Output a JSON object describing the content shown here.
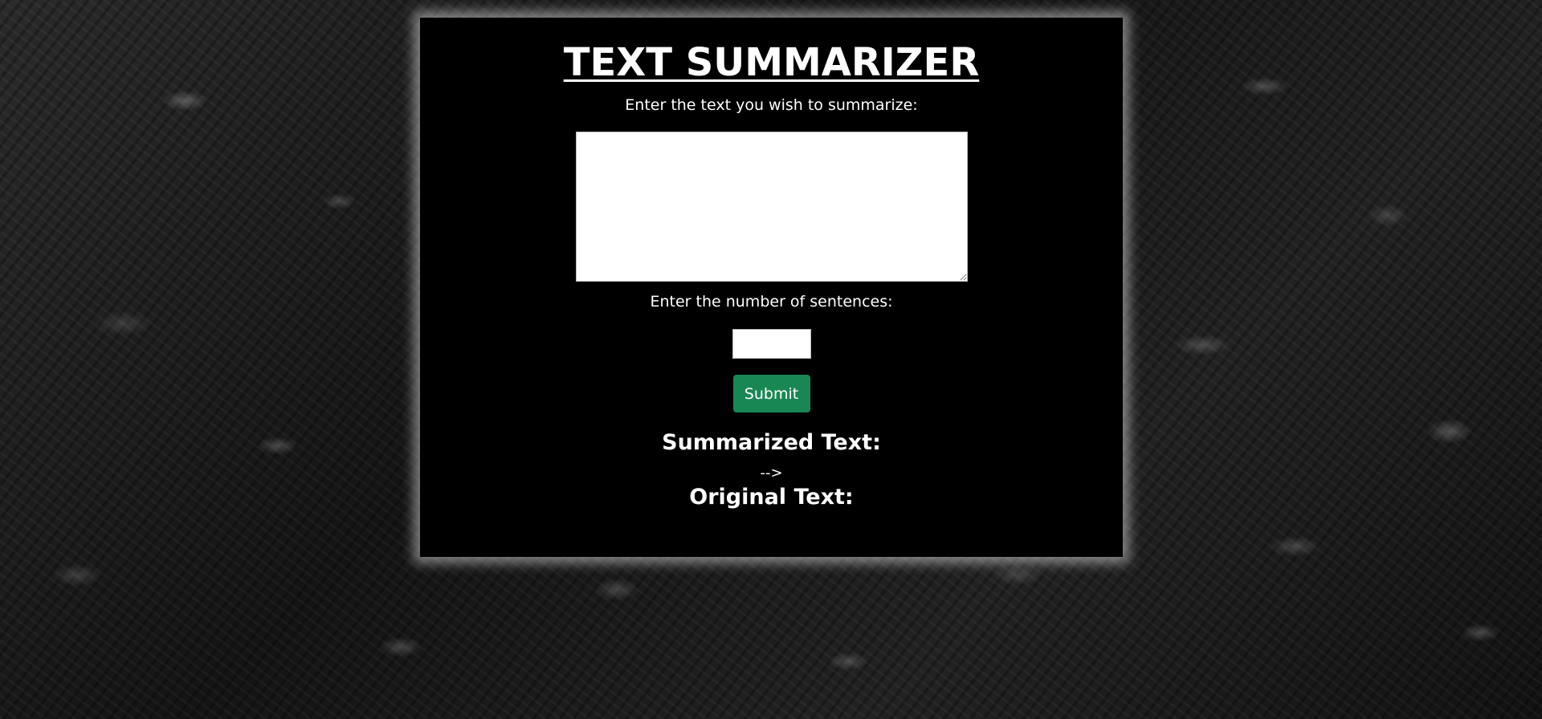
{
  "app": {
    "title": "TEXT SUMMARIZER"
  },
  "form": {
    "text_label": "Enter the text you wish to summarize:",
    "text_value": "",
    "sentences_label": "Enter the number of sentences:",
    "sentences_value": "",
    "submit_label": "Submit"
  },
  "results": {
    "summarized_heading": "Summarized Text:",
    "stray_text": "-->",
    "original_heading": "Original Text:"
  },
  "colors": {
    "panel_background": "#000000",
    "submit_button": "#198754",
    "text": "#ffffff"
  }
}
